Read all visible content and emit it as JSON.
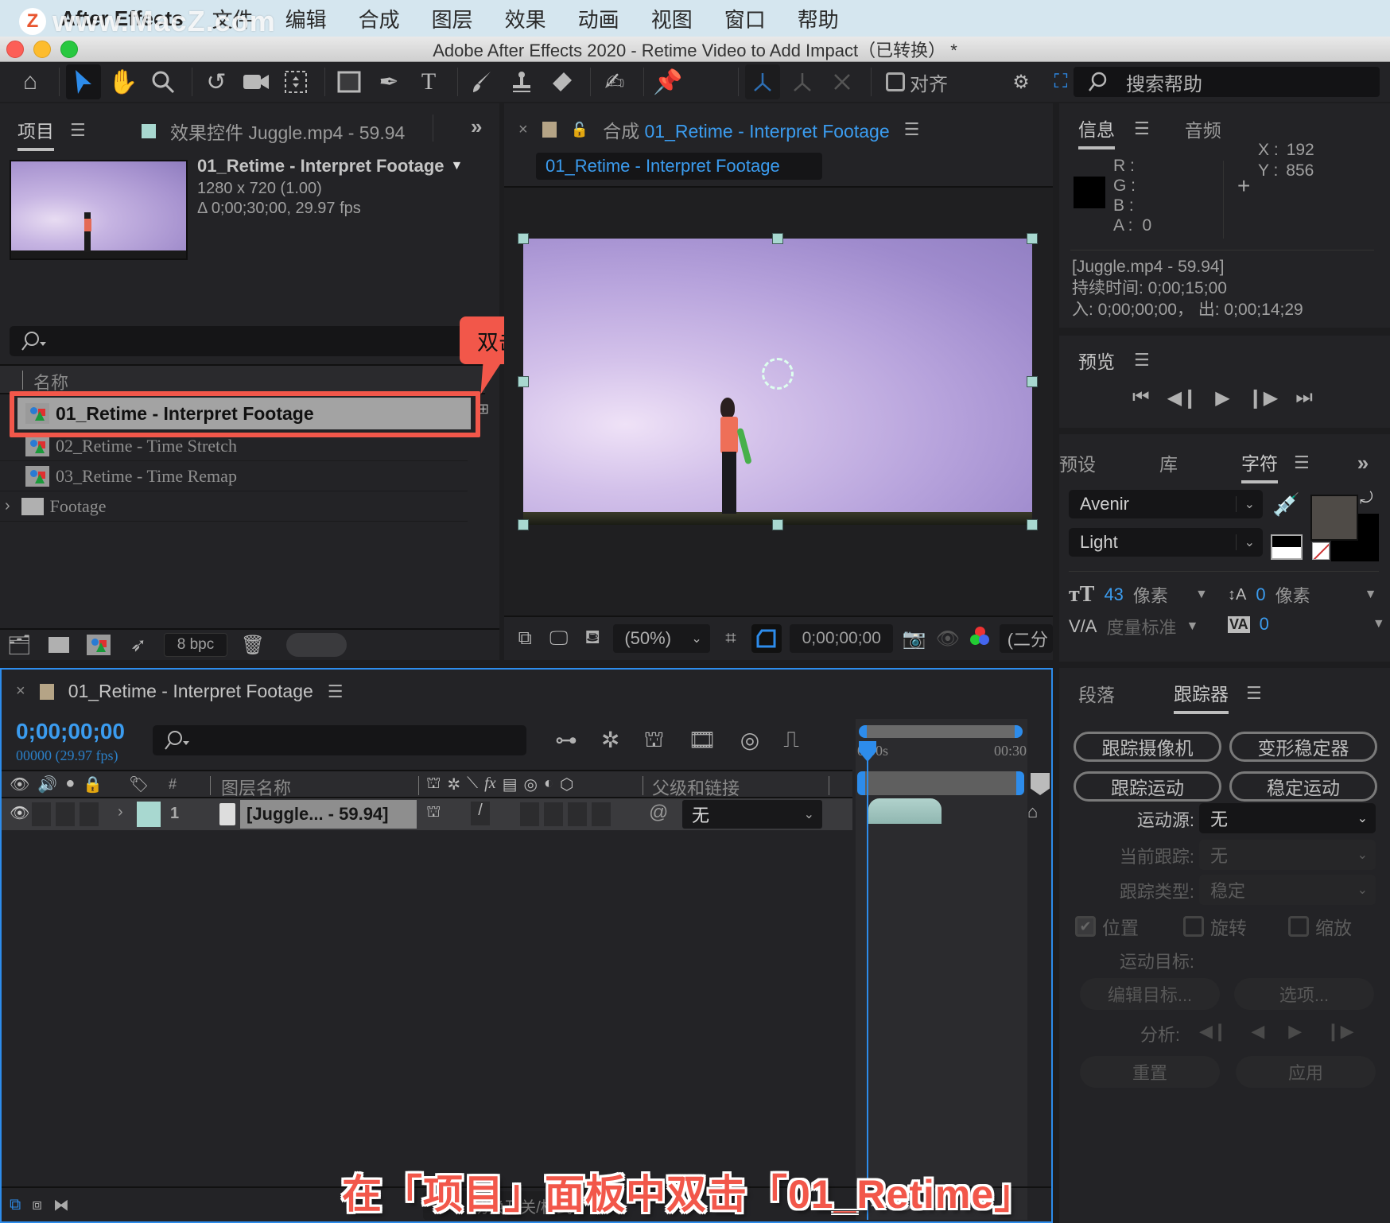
{
  "menubar": {
    "watermark": "www.MacZ.com",
    "watermark_badge": "Z",
    "app_name": "After Effects",
    "items": [
      "文件",
      "编辑",
      "合成",
      "图层",
      "效果",
      "动画",
      "视图",
      "窗口",
      "帮助"
    ]
  },
  "window": {
    "title": "Adobe After Effects 2020 - Retime Video to Add Impact（已转换） *"
  },
  "toolbar": {
    "tools": [
      "home-icon",
      "selection-tool-icon",
      "hand-tool-icon",
      "zoom-tool-icon",
      "rotate-tool-icon",
      "camera-tool-icon",
      "pan-behind-tool-icon",
      "rectangle-tool-icon",
      "pen-tool-icon",
      "type-tool-icon",
      "brush-tool-icon",
      "clone-stamp-tool-icon",
      "eraser-tool-icon",
      "roto-brush-tool-icon",
      "puppet-pin-tool-icon"
    ],
    "align_label": "对齐",
    "help_search_placeholder": "搜索帮助"
  },
  "project_panel": {
    "tab_project": "项目",
    "tab_effects": "效果控件 Juggle.mp4 - 59.94",
    "effects_swatch": "#a8d8d0",
    "selected_item_title": "01_Retime - Interpret Footage",
    "selected_item_size": "1280 x 720 (1.00)",
    "selected_item_duration": "Δ 0;00;30;00, 29.97 fps",
    "column_name": "名称",
    "items": [
      {
        "name": "01_Retime - Interpret Footage",
        "type": "composition",
        "selected": true
      },
      {
        "name": "02_Retime - Time Stretch",
        "type": "composition",
        "selected": false
      },
      {
        "name": "03_Retime - Time Remap",
        "type": "composition",
        "selected": false
      },
      {
        "name": "Footage",
        "type": "folder",
        "selected": false
      }
    ],
    "bpc": "8 bpc"
  },
  "annotation": {
    "callout": "双击",
    "caption": "在「项目」面板中双击「01_Retime」",
    "color": "#f2574a"
  },
  "composition_panel": {
    "tab_prefix": "合成",
    "tab_name": "01_Retime - Interpret Footage",
    "label_swatch": "#b5a486",
    "breadcrumb": "01_Retime - Interpret Footage",
    "magnification": "(50%)",
    "timecode": "0;00;00;00",
    "resolution": "(二分"
  },
  "info_panel": {
    "tab_info": "信息",
    "tab_audio": "音频",
    "r_label": "R :",
    "g_label": "G :",
    "b_label": "B :",
    "a_label": "A :",
    "a_value": "0",
    "x_label": "X :",
    "x_value": "192",
    "y_label": "Y :",
    "y_value": "856",
    "source_name": "[Juggle.mp4 - 59.94]",
    "duration": "持续时间: 0;00;15;00",
    "in_out": "入: 0;00;00;00，  出: 0;00;14;29"
  },
  "preview_panel": {
    "title": "预览"
  },
  "character_panel": {
    "tab_presets": "预设",
    "tab_library": "库",
    "tab_character": "字符",
    "font_family": "Avenir",
    "font_style": "Light",
    "font_size": "43",
    "font_size_unit": "像素",
    "leading": "0",
    "leading_unit": "像素",
    "kerning": "度量标准",
    "tracking": "0",
    "fill_color": "#4f4b47",
    "stroke_color": "#000000"
  },
  "tracker_panel": {
    "tab_paragraph": "段落",
    "tab_tracker": "跟踪器",
    "btn_track_camera": "跟踪摄像机",
    "btn_warp_stabilizer": "变形稳定器",
    "btn_track_motion": "跟踪运动",
    "btn_stabilize_motion": "稳定运动",
    "motion_source_label": "运动源:",
    "motion_source_value": "无",
    "current_track_label": "当前跟踪:",
    "current_track_value": "无",
    "track_type_label": "跟踪类型:",
    "track_type_value": "稳定",
    "chk_position": "位置",
    "chk_position_checked": true,
    "chk_rotation": "旋转",
    "chk_rotation_checked": false,
    "chk_scale": "缩放",
    "chk_scale_checked": false,
    "motion_target_label": "运动目标:",
    "btn_edit_target": "编辑目标...",
    "btn_options": "选项...",
    "analyze_label": "分析:",
    "btn_reset": "重置",
    "btn_apply": "应用"
  },
  "timeline_panel": {
    "tab_name": "01_Retime - Interpret Footage",
    "label_swatch": "#b5a486",
    "timecode": "0;00;00;00",
    "frames": "00000 (29.97 fps)",
    "col_number": "#",
    "col_layer_name": "图层名称",
    "col_parent": "父级和链接",
    "ruler_start": "0:00s",
    "ruler_end": "00:30",
    "layer": {
      "index": "1",
      "name": "[Juggle... - 59.94]",
      "label_color": "#a8d8d0",
      "parent": "无"
    },
    "toggle_modes": "切换开关/模式"
  }
}
